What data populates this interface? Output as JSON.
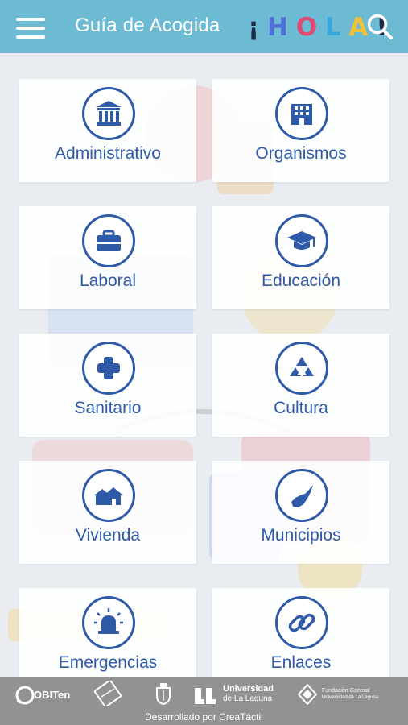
{
  "header": {
    "app_title": "Guía de Acogida",
    "logo_text": "¡HOLA!",
    "logo_letters": [
      {
        "char": "¡",
        "color": "#1f2a44"
      },
      {
        "char": "H",
        "color": "#4f6fd8"
      },
      {
        "char": "O",
        "color": "#df4a73"
      },
      {
        "char": "L",
        "color": "#38a8db"
      },
      {
        "char": "A",
        "color": "#f2c13a"
      },
      {
        "char": "!",
        "color": "#1f2a44"
      }
    ],
    "menu_icon": "hamburger-menu-icon",
    "search_icon": "search-icon"
  },
  "menu": {
    "items": [
      {
        "label": "Administrativo",
        "icon": "building-columns-icon"
      },
      {
        "label": "Organismos",
        "icon": "office-building-icon"
      },
      {
        "label": "Laboral",
        "icon": "briefcase-icon"
      },
      {
        "label": "Educación",
        "icon": "graduation-cap-icon"
      },
      {
        "label": "Sanitario",
        "icon": "medical-cross-icon"
      },
      {
        "label": "Cultura",
        "icon": "pyramid-triangles-icon"
      },
      {
        "label": "Vivienda",
        "icon": "houses-icon"
      },
      {
        "label": "Municipios",
        "icon": "island-map-icon"
      },
      {
        "label": "Emergencias",
        "icon": "siren-icon"
      },
      {
        "label": "Enlaces",
        "icon": "link-chain-icon"
      }
    ]
  },
  "footer": {
    "logos": {
      "obiten": "OBITen",
      "universidad_line1": "Universidad",
      "universidad_line2": "de La Laguna",
      "fundacion_line1": "Fundación General",
      "fundacion_line2": "Universidad de La Laguna"
    },
    "credit": "Desarrollado por CreaTáctil"
  },
  "colors": {
    "header_bg": "#6dbad3",
    "accent_blue": "#2e5aa8",
    "footer_bg": "#929292",
    "page_bg": "#e9edf2"
  }
}
